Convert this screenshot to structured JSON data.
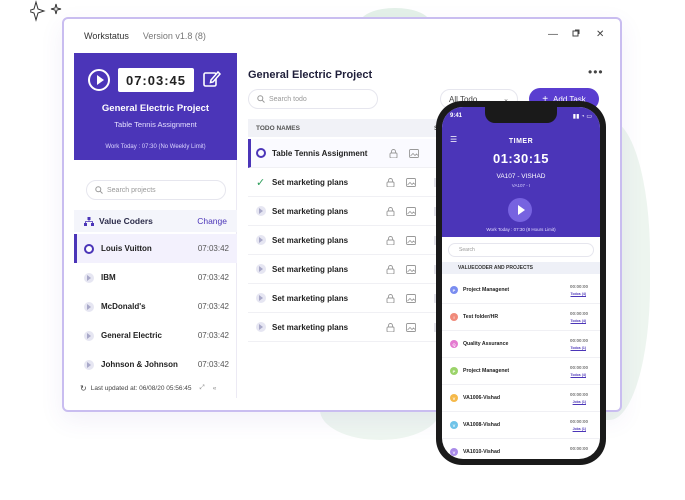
{
  "window": {
    "app_title": "Workstatus",
    "version": "Version v1.8 (8)",
    "controls": [
      "minimize-icon",
      "restore-icon",
      "close-icon"
    ]
  },
  "sidebar": {
    "timer": "07:03:45",
    "current_project": "General Electric Project",
    "current_task": "Table Tennis Assignment",
    "work_today": "Work Today : 07:30 (No Weekly Limit)",
    "search_placeholder": "Search projects",
    "org_name": "Value Coders",
    "change_label": "Change",
    "projects": [
      {
        "name": "Louis Vuitton",
        "time": "07:03:42",
        "active": true
      },
      {
        "name": "IBM",
        "time": "07:03:42"
      },
      {
        "name": "McDonald's",
        "time": "07:03:42"
      },
      {
        "name": "General Electric",
        "time": "07:03:42"
      },
      {
        "name": "Johnson & Johnson",
        "time": "07:03:42"
      }
    ],
    "last_updated": "Last updated at: 06/08/20  05:56:45"
  },
  "main": {
    "project_title": "General Electric Project",
    "search_placeholder": "Search todo",
    "filter_label": "All Todo",
    "add_task_label": "Add Task",
    "col_todo_names": "TODO NAMES",
    "col_s": "S",
    "todos": [
      {
        "name": "Table Tennis Assignment",
        "state": "active"
      },
      {
        "name": "Set marketing plans",
        "state": "done"
      },
      {
        "name": "Set marketing plans",
        "state": "idle"
      },
      {
        "name": "Set marketing plans",
        "state": "idle"
      },
      {
        "name": "Set marketing plans",
        "state": "idle"
      },
      {
        "name": "Set marketing plans",
        "state": "idle"
      },
      {
        "name": "Set marketing plans",
        "state": "idle"
      }
    ]
  },
  "phone": {
    "clock": "9:41",
    "title": "TIMER",
    "timer": "01:30:15",
    "project": "VA107 - VISHAD",
    "sub": "VA107 - I",
    "work_today": "Work Today : 07:30 (8 Hours Limit)",
    "search_placeholder": "Search",
    "org_label": "VALUECODER AND PROJECTS",
    "items": [
      {
        "badge": "P",
        "color": "#7a8df0",
        "name": "Project Managenet",
        "time": "00:00:00",
        "link": "Todos (4)"
      },
      {
        "badge": "!",
        "color": "#f08a7a",
        "name": "Test folder/HR",
        "time": "00:00:00",
        "link": "Todos (4)"
      },
      {
        "badge": "Q",
        "color": "#e47ad0",
        "name": "Quality Assurance",
        "time": "00:00:00",
        "link": "Todos (1)"
      },
      {
        "badge": "P",
        "color": "#9bd36a",
        "name": "Project Managenet",
        "time": "00:00:00",
        "link": "Todos (4)"
      },
      {
        "badge": "V",
        "color": "#f5b94a",
        "name": "VA1006-Vishad",
        "time": "00:00:00",
        "link": "Jobs (1)"
      },
      {
        "badge": "V",
        "color": "#6fc3e8",
        "name": "VA1008-Vishad",
        "time": "00:00:00",
        "link": "Jobs (1)"
      },
      {
        "badge": "V",
        "color": "#a98be8",
        "name": "VA1010-Vishad",
        "time": "00:00:00",
        "link": ""
      }
    ]
  }
}
